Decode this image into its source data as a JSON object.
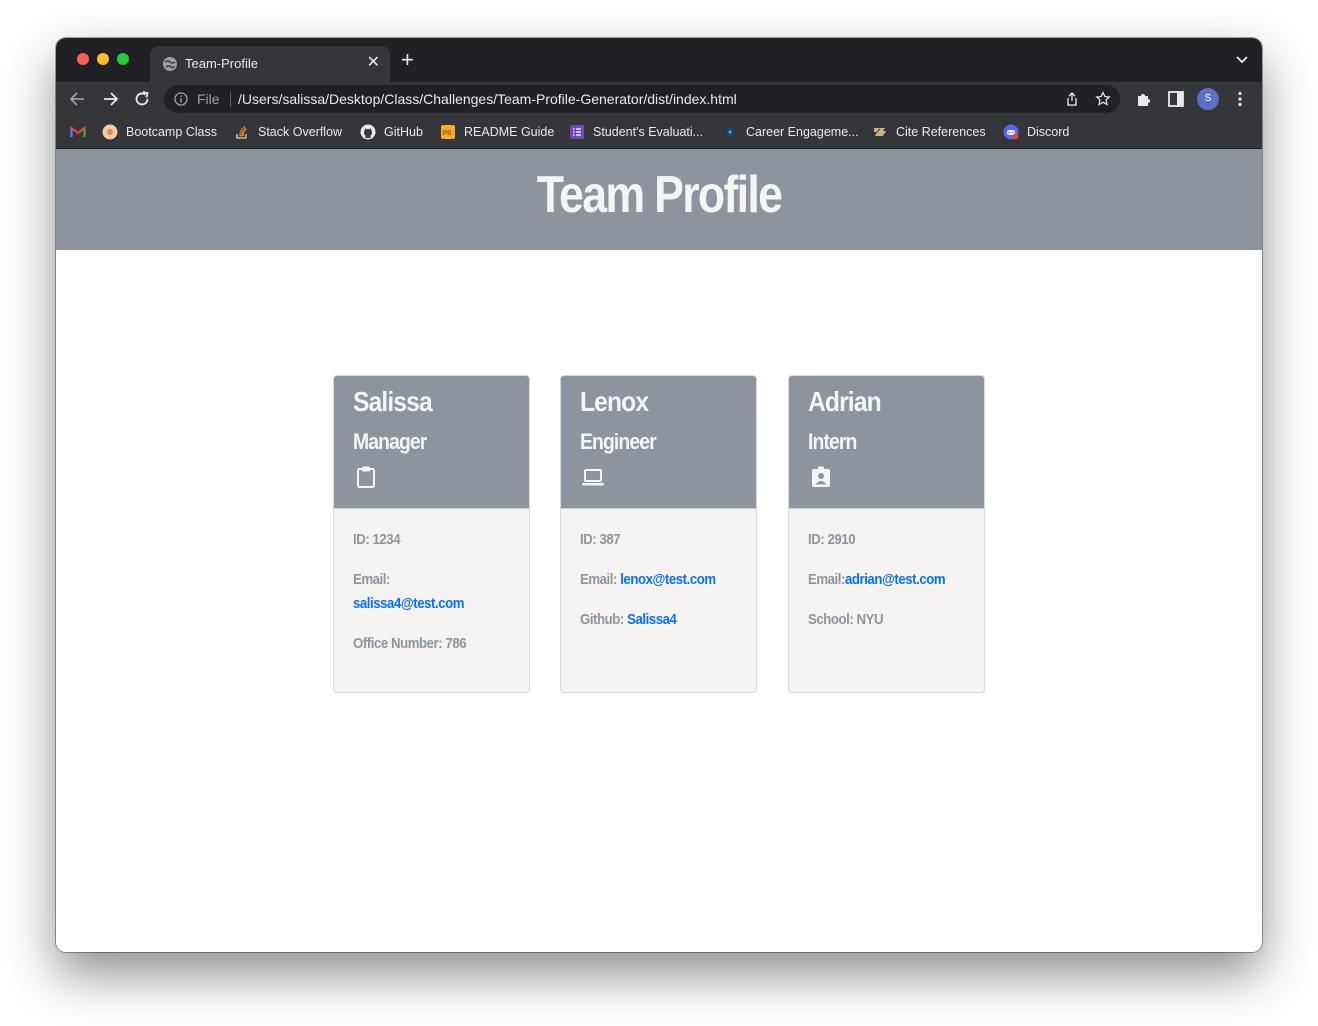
{
  "browser": {
    "tab_title": "Team-Profile",
    "address_scheme": "File",
    "address_url": "/Users/salissa/Desktop/Class/Challenges/Team-Profile-Generator/dist/index.html",
    "profile_initial": "S",
    "bookmarks": [
      {
        "label": "",
        "icon": "gmail-icon"
      },
      {
        "label": "Bootcamp Class",
        "icon": "bootcamp-icon"
      },
      {
        "label": "Stack Overflow",
        "icon": "stackoverflow-icon"
      },
      {
        "label": "GitHub",
        "icon": "github-icon"
      },
      {
        "label": "README Guide",
        "icon": "readme-icon"
      },
      {
        "label": "Student's Evaluati...",
        "icon": "form-icon"
      },
      {
        "label": "Career Engageme...",
        "icon": "career-icon"
      },
      {
        "label": "Cite References",
        "icon": "cite-icon"
      },
      {
        "label": "Discord",
        "icon": "discord-icon"
      }
    ]
  },
  "page": {
    "title": "Team Profile",
    "colors": {
      "header": "#8c959e",
      "card_body": "#f5f4f3",
      "link": "#0d6efd"
    },
    "cards": [
      {
        "name": "Salissa",
        "role": "Manager",
        "icon": "clipboard-icon",
        "id_line": "ID: 1234",
        "email_label": "Email:",
        "email": "salissa4@test.com",
        "extra_label": "Office Number: 786",
        "extra_value": ""
      },
      {
        "name": "Lenox",
        "role": "Engineer",
        "icon": "laptop-icon",
        "id_line": "ID: 387",
        "email_label": "Email:",
        "email": "lenox@test.com",
        "extra_label": "Github:",
        "extra_value": "Salissa4"
      },
      {
        "name": "Adrian",
        "role": "Intern",
        "icon": "id-badge-icon",
        "id_line": "ID: 2910",
        "email_label": "Email:",
        "email": "adrian@test.com",
        "extra_label": "School: NYU",
        "extra_value": ""
      }
    ]
  }
}
